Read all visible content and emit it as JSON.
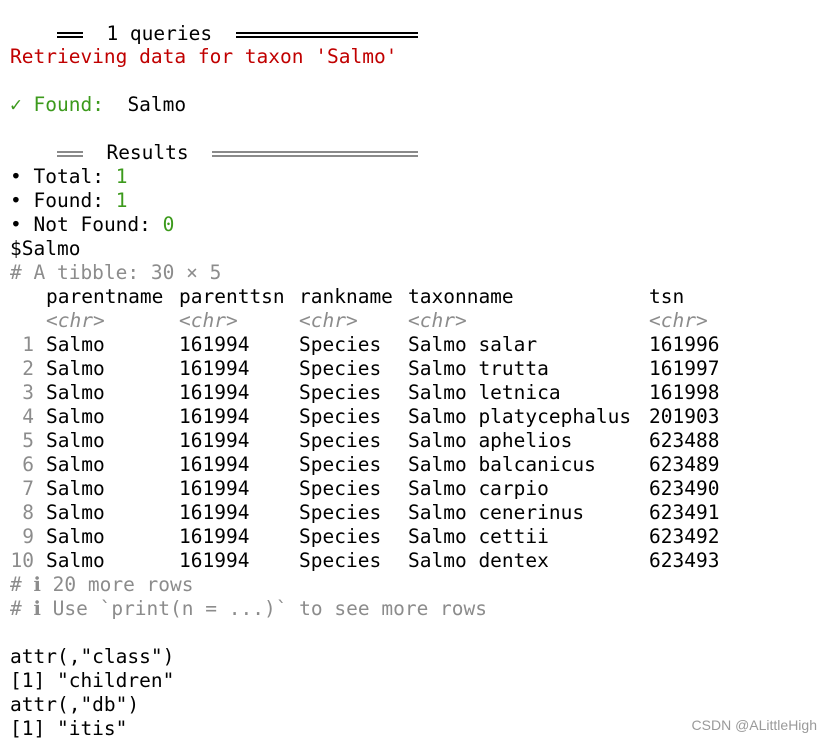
{
  "header": {
    "rule_left": "══",
    "label": "1 queries",
    "rule_right": "═══════════════"
  },
  "retrieving_msg": "Retrieving data for taxon 'Salmo'",
  "found_line": {
    "check": "✓",
    "label": "Found:",
    "value": "Salmo"
  },
  "results_header": {
    "rule_left": "══",
    "label": "Results",
    "rule_right": "═══════════════"
  },
  "summary": [
    {
      "bullet": "•",
      "label": "Total:",
      "value": "1"
    },
    {
      "bullet": "•",
      "label": "Found:",
      "value": "1"
    },
    {
      "bullet": "•",
      "label": "Not Found:",
      "value": "0"
    }
  ],
  "list_name": "$Salmo",
  "tibble_comment": "# A tibble: 30 × 5",
  "columns": [
    {
      "name": "parentname",
      "type": "<chr>"
    },
    {
      "name": "parenttsn",
      "type": "<chr>"
    },
    {
      "name": "rankname",
      "type": "<chr>"
    },
    {
      "name": "taxonname",
      "type": "<chr>"
    },
    {
      "name": "tsn",
      "type": "<chr>"
    }
  ],
  "rows": [
    {
      "idx": "1",
      "cells": [
        "Salmo",
        "161994",
        "Species",
        "Salmo salar",
        "161996"
      ]
    },
    {
      "idx": "2",
      "cells": [
        "Salmo",
        "161994",
        "Species",
        "Salmo trutta",
        "161997"
      ]
    },
    {
      "idx": "3",
      "cells": [
        "Salmo",
        "161994",
        "Species",
        "Salmo letnica",
        "161998"
      ]
    },
    {
      "idx": "4",
      "cells": [
        "Salmo",
        "161994",
        "Species",
        "Salmo platycephalus",
        "201903"
      ]
    },
    {
      "idx": "5",
      "cells": [
        "Salmo",
        "161994",
        "Species",
        "Salmo aphelios",
        "623488"
      ]
    },
    {
      "idx": "6",
      "cells": [
        "Salmo",
        "161994",
        "Species",
        "Salmo balcanicus",
        "623489"
      ]
    },
    {
      "idx": "7",
      "cells": [
        "Salmo",
        "161994",
        "Species",
        "Salmo carpio",
        "623490"
      ]
    },
    {
      "idx": "8",
      "cells": [
        "Salmo",
        "161994",
        "Species",
        "Salmo cenerinus",
        "623491"
      ]
    },
    {
      "idx": "9",
      "cells": [
        "Salmo",
        "161994",
        "Species",
        "Salmo cettii",
        "623492"
      ]
    },
    {
      "idx": "10",
      "cells": [
        "Salmo",
        "161994",
        "Species",
        "Salmo dentex",
        "623493"
      ]
    }
  ],
  "footer_comments": [
    "# ℹ 20 more rows",
    "# ℹ Use `print(n = ...)` to see more rows"
  ],
  "attributes": [
    "attr(,\"class\")",
    "[1] \"children\"",
    "attr(,\"db\")",
    "[1] \"itis\""
  ],
  "watermark": "CSDN @ALittleHigh",
  "colors": {
    "error_red": "#c00000",
    "success_green": "#3c9a1c",
    "comment_grey": "#8c8c8c"
  }
}
